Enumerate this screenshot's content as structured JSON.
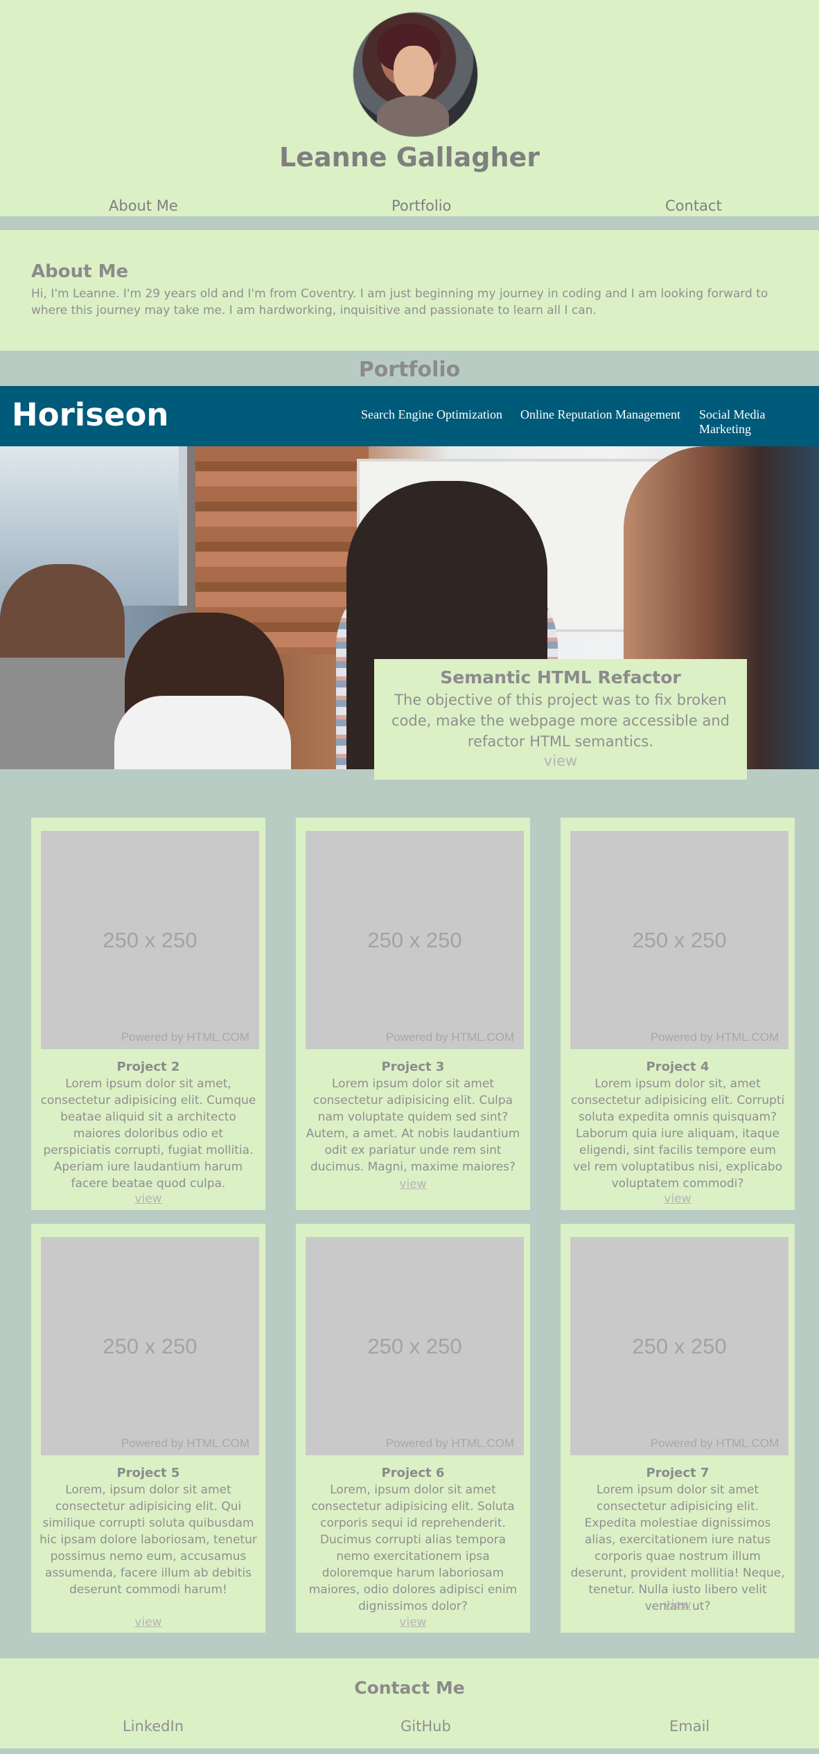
{
  "header": {
    "name": "Leanne Gallagher",
    "avatar_icon": "profile-photo"
  },
  "nav": {
    "about": "About Me",
    "portfolio": "Portfolio",
    "contact": "Contact"
  },
  "about": {
    "title": "About Me",
    "text": "Hi, I'm Leanne. I'm 29 years old and I'm from Coventry. I am just beginning my journey in coding and I am looking forward to where this journey may take me. I am hardworking, inquisitive and passionate to learn all I can."
  },
  "portfolio": {
    "title": "Portfolio",
    "featured": {
      "brand": "Horiseon",
      "links": [
        "Search Engine Optimization",
        "Online Reputation Management",
        "Social Media Marketing"
      ],
      "title": "Semantic HTML Refactor",
      "description": "The objective of this project was to fix broken code, make the webpage more accessible and refactor HTML semantics.",
      "view": "view"
    },
    "placeholder": {
      "size": "250 x 250",
      "powered": "Powered by HTML.COM"
    },
    "projects": [
      {
        "title": "Project 2",
        "description": "Lorem ipsum dolor sit amet, consectetur adipisicing elit. Cumque beatae aliquid sit a architecto maiores doloribus odio et perspiciatis corrupti, fugiat mollitia. Aperiam iure laudantium harum facere beatae quod culpa.",
        "view": "view"
      },
      {
        "title": "Project 3",
        "description": "Lorem ipsum dolor sit amet consectetur adipisicing elit. Culpa nam voluptate quidem sed sint? Autem, a amet. At nobis laudantium odit ex pariatur unde rem sint ducimus. Magni, maxime maiores?",
        "view": "view"
      },
      {
        "title": "Project 4",
        "description": "Lorem ipsum dolor sit, amet consectetur adipisicing elit. Corrupti soluta expedita omnis quisquam? Laborum quia iure aliquam, itaque eligendi, sint facilis tempore eum vel rem voluptatibus nisi, explicabo voluptatem commodi?",
        "view": "view"
      },
      {
        "title": "Project 5",
        "description": "Lorem, ipsum dolor sit amet consectetur adipisicing elit. Qui similique corrupti soluta quibusdam hic ipsam dolore laboriosam, tenetur possimus nemo eum, accusamus assumenda, facere illum ab debitis deserunt commodi harum!",
        "view": "view"
      },
      {
        "title": "Project 6",
        "description": "Lorem, ipsum dolor sit amet consectetur adipisicing elit. Soluta corporis sequi id reprehenderit. Ducimus corrupti alias tempora nemo exercitationem ipsa doloremque harum laboriosam maiores, odio dolores adipisci enim dignissimos dolor?",
        "view": "view"
      },
      {
        "title": "Project 7",
        "description": "Lorem ipsum dolor sit amet consectetur adipisicing elit. Expedita molestiae dignissimos alias, exercitationem iure natus corporis quae nostrum illum deserunt, provident mollitia! Neque, tenetur. Nulla iusto libero velit veniam ut?",
        "view": "view"
      }
    ]
  },
  "contact": {
    "title": "Contact Me",
    "links": [
      "LinkedIn",
      "GitHub",
      "Email"
    ]
  },
  "colors": {
    "light_green": "#dcf0c6",
    "blue_gray": "#b8ccc4",
    "horiseon_blue": "#005a7a",
    "placeholder_gray": "#c9c9c9"
  }
}
